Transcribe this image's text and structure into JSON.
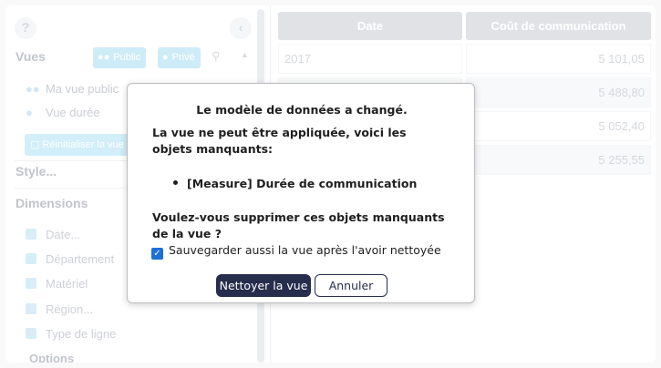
{
  "sidebar": {
    "help_glyph": "?",
    "collapse_glyph": "‹",
    "views_title": "Vues",
    "chips": {
      "public_label": "Public",
      "private_label": "Privé"
    },
    "views": [
      {
        "label": "Ma vue public",
        "icon": "users-icon"
      },
      {
        "label": "Vue durée",
        "icon": "user-icon"
      }
    ],
    "reset_label": "Réinitialiser la vue",
    "style_title": "Style...",
    "dimensions_title": "Dimensions",
    "dimensions": [
      {
        "label": "Date..."
      },
      {
        "label": "Département"
      },
      {
        "label": "Matériel"
      },
      {
        "label": "Région..."
      },
      {
        "label": "Type de ligne"
      }
    ],
    "options_title": "Options"
  },
  "table": {
    "headers": [
      "Date",
      "Coût de communication"
    ],
    "rows": [
      {
        "date": "2017",
        "value": "5 101,05"
      },
      {
        "date": "",
        "value": "5 488,80"
      },
      {
        "date": "",
        "value": "5 052,40"
      },
      {
        "date": "",
        "value": "5 255,55"
      }
    ]
  },
  "dialog": {
    "title": "Le modèle de données a changé.",
    "message": "La vue ne peut être appliquée, voici les objets manquants:",
    "missing_item": "[Measure] Durée de communication",
    "question": "Voulez-vous supprimer ces objets manquants de la vue ?",
    "checkbox_label": "Sauvegarder aussi la vue après l'avoir nettoyée",
    "checkbox_checked": true,
    "confirm_label": "Nettoyer la vue",
    "cancel_label": "Annuler"
  },
  "colors": {
    "accent": "#a6dbf2",
    "primary_button": "#272d4d",
    "header_bg": "#c7cad1"
  }
}
